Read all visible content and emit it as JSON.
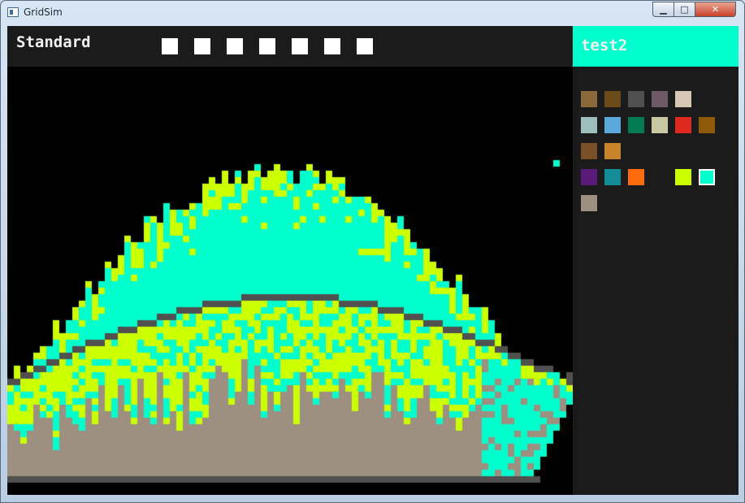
{
  "window": {
    "title": "GridSim",
    "min_glyph": "▁",
    "max_glyph": "□",
    "close_glyph": "✕"
  },
  "toolbar": {
    "mode": "Standard",
    "slot_count": 7
  },
  "palette": {
    "selected_name": "test2",
    "selected_color": "#00ffcc",
    "rows": [
      [
        "#8b6a3a",
        "#6b4a1a",
        "#505050",
        "#6e5a66",
        "#d6c8b4"
      ],
      [
        "#9fbebe",
        "#5aa8dc",
        "#007a50",
        "#c8c8a4",
        "#dc281e",
        "#8c5a0a"
      ],
      [
        "#7a5028",
        "#c8822a"
      ],
      [
        "#5a1a7a",
        "#148c96",
        "#ff6a0a",
        null,
        "#ccff00",
        "#00ffcc"
      ],
      [
        "#9e9080"
      ]
    ]
  },
  "simulation": {
    "colors": {
      "sky": "#000000",
      "sand": "#9e9080",
      "aqua": "#00ffcc",
      "lime": "#ccff00",
      "wall": "#505050"
    },
    "floating_particle_color": "#00ffcc"
  }
}
